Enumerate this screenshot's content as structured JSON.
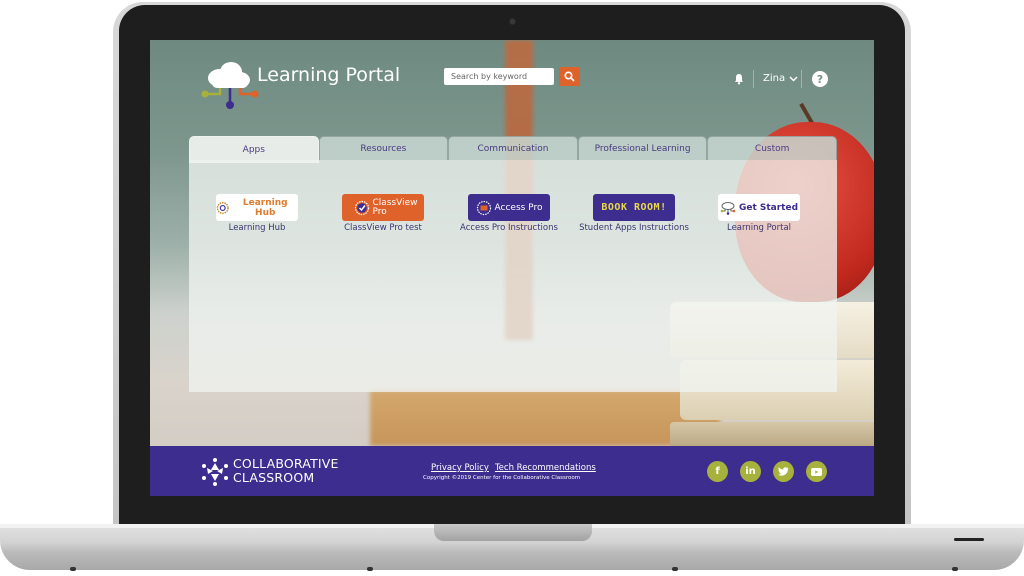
{
  "header": {
    "title": "Learning Portal",
    "search_placeholder": "Search by keyword",
    "user_name": "Zina",
    "help_glyph": "?",
    "icons": {
      "logo": "cloud-network-logo-icon",
      "search": "search-icon",
      "notifications": "bell-icon",
      "user_menu": "chevron-down-icon",
      "help": "help-icon"
    }
  },
  "tabs": [
    {
      "label": "Apps",
      "active": true
    },
    {
      "label": "Resources",
      "active": false
    },
    {
      "label": "Communication",
      "active": false
    },
    {
      "label": "Professional Learning",
      "active": false
    },
    {
      "label": "Custom",
      "active": false
    }
  ],
  "apps": [
    {
      "logo_text": "Learning Hub",
      "caption": "Learning Hub",
      "logo_bg": "#ffffff",
      "logo_color": "#e07b2e"
    },
    {
      "logo_text": "ClassView Pro",
      "caption": "ClassView Pro test",
      "logo_bg": "#e0622b",
      "logo_color": "#ffffff"
    },
    {
      "logo_text": "Access Pro",
      "caption": "Access Pro Instructions",
      "logo_bg": "#3c2d8e",
      "logo_color": "#ffffff"
    },
    {
      "logo_text": "BOOK ROOM!",
      "caption": "Student Apps Instructions",
      "logo_bg": "#3c2d8e",
      "logo_color": "#e8d84a"
    },
    {
      "logo_text": "Get Started",
      "caption": "Learning Portal",
      "logo_bg": "#ffffff",
      "logo_color": "#3c2d8e"
    }
  ],
  "footer": {
    "brand_line1": "COLLABORATIVE",
    "brand_line2": "CLASSROOM",
    "links": [
      "Privacy Policy",
      "Tech Recommendations"
    ],
    "copyright": "Copyright ©2019 Center for the Collaborative Classroom",
    "social": [
      {
        "name": "facebook",
        "glyph": "f"
      },
      {
        "name": "linkedin",
        "glyph": "in"
      },
      {
        "name": "twitter",
        "glyph": "t"
      },
      {
        "name": "youtube",
        "glyph": "▶"
      }
    ]
  },
  "colors": {
    "brand_purple": "#3c2d8e",
    "accent_orange": "#e0622b",
    "social_green": "#a7b23c"
  }
}
